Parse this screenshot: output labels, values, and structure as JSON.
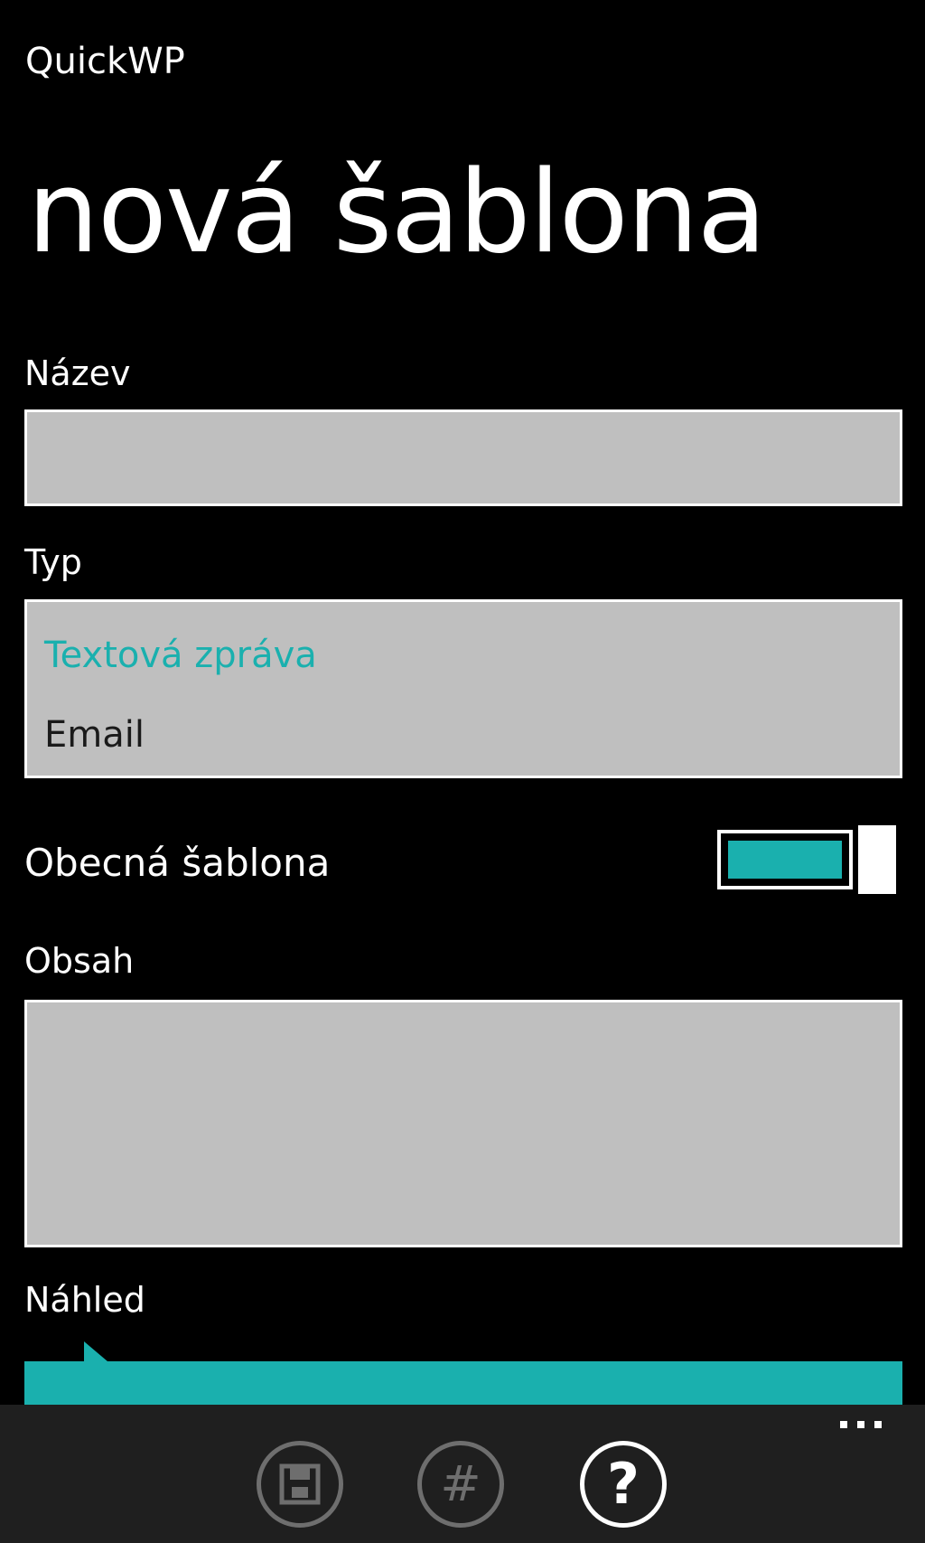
{
  "app": {
    "title": "QuickWP"
  },
  "page": {
    "title": "nová šablona"
  },
  "colors": {
    "accent": "#1ab0ae",
    "field_bg": "#bfbfbf",
    "app_bar_bg": "#1f1f1f",
    "inactive_icon": "#6e6e6e"
  },
  "form": {
    "name": {
      "label": "Název",
      "value": ""
    },
    "type": {
      "label": "Typ",
      "options": [
        {
          "label": "Textová zpráva",
          "selected": true
        },
        {
          "label": "Email",
          "selected": false
        }
      ]
    },
    "general": {
      "label": "Obecná šablona",
      "on": true
    },
    "content": {
      "label": "Obsah",
      "value": ""
    },
    "preview": {
      "label": "Náhled"
    }
  },
  "app_bar": {
    "buttons": [
      {
        "icon": "save-icon",
        "enabled": false
      },
      {
        "icon": "hash-icon",
        "enabled": false
      },
      {
        "icon": "help-icon",
        "enabled": true
      }
    ],
    "more_icon": "ellipsis-icon"
  }
}
